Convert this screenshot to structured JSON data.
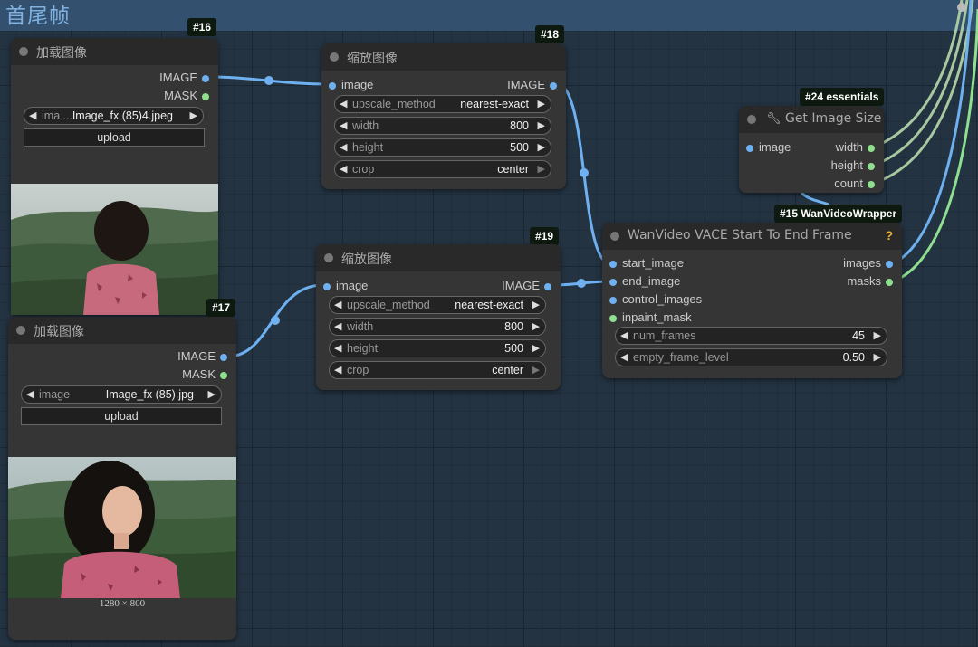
{
  "group": {
    "title": "首尾帧"
  },
  "nodes": {
    "load16": {
      "badge": "#16",
      "title": "加载图像",
      "outputs": [
        "IMAGE",
        "MASK"
      ],
      "image_widget": {
        "label": "ima ...",
        "value": "Image_fx (85)4.jpeg"
      },
      "upload_label": "upload"
    },
    "load17": {
      "badge": "#17",
      "title": "加载图像",
      "outputs": [
        "IMAGE",
        "MASK"
      ],
      "image_widget": {
        "label": "image",
        "value": "Image_fx (85).jpg"
      },
      "upload_label": "upload",
      "caption": "1280 × 800"
    },
    "scale18": {
      "badge": "#18",
      "title": "缩放图像",
      "input": "image",
      "output": "IMAGE",
      "widgets": [
        {
          "label": "upscale_method",
          "value": "nearest-exact"
        },
        {
          "label": "width",
          "value": "800"
        },
        {
          "label": "height",
          "value": "500"
        },
        {
          "label": "crop",
          "value": "center"
        }
      ]
    },
    "scale19": {
      "badge": "#19",
      "title": "缩放图像",
      "input": "image",
      "output": "IMAGE",
      "widgets": [
        {
          "label": "upscale_method",
          "value": "nearest-exact"
        },
        {
          "label": "width",
          "value": "800"
        },
        {
          "label": "height",
          "value": "500"
        },
        {
          "label": "crop",
          "value": "center"
        }
      ]
    },
    "size24": {
      "badge": "#24 essentials",
      "title": "Get Image Size",
      "input": "image",
      "outputs": [
        "width",
        "height",
        "count"
      ]
    },
    "vace15": {
      "badge": "#15 WanVideoWrapper",
      "title": "WanVideo VACE Start To End Frame",
      "help": "?",
      "inputs": [
        "start_image",
        "end_image",
        "control_images",
        "inpaint_mask"
      ],
      "outputs": [
        "images",
        "masks"
      ],
      "widgets": [
        {
          "label": "num_frames",
          "value": "45"
        },
        {
          "label": "empty_frame_level",
          "value": "0.50"
        }
      ]
    }
  },
  "colors": {
    "image_link": "#6fb1f0",
    "mask_link": "#8ee08e",
    "int_link": "#a8c8a0"
  },
  "icons": {
    "arrow_left": "◀",
    "arrow_right": "▶",
    "wrench": "wrench-icon"
  }
}
